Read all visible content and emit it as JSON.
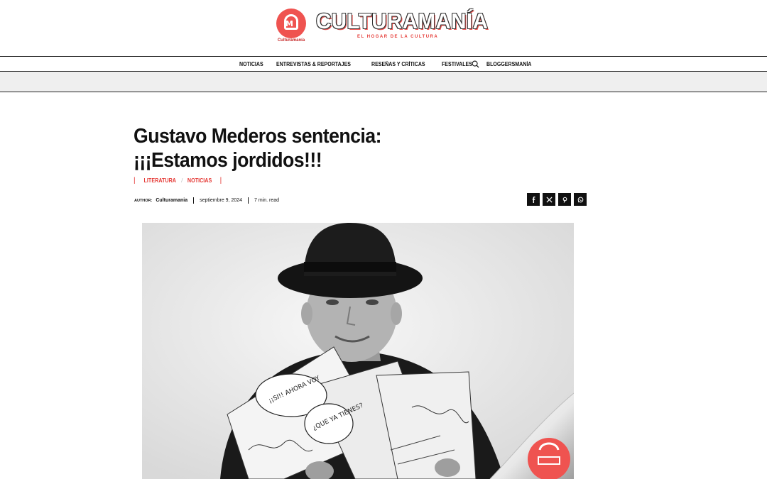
{
  "header": {
    "brand": "CULTURAMANÍA",
    "tagline": "EL HOGAR DE LA CULTURA",
    "logo_caption": "Culturamanía"
  },
  "nav": {
    "items": [
      "NOTICIAS",
      "ENTREVISTAS & REPORTAJES",
      "RESEÑAS Y CRÍTICAS",
      "FESTIVALES",
      "BLOGGERSMANÍA"
    ]
  },
  "article": {
    "title": "Gustavo Mederos sentencia: ¡¡¡Estamos jordidos!!!",
    "categories": [
      "LITERATURA",
      "NOTICIAS"
    ],
    "author_label": "AUTHOR:",
    "author": "Culturamania",
    "date": "septiembre 9, 2024",
    "read_time": "7 min. read"
  },
  "share": {
    "buttons": [
      "facebook-icon",
      "x-icon",
      "pinterest-icon",
      "whatsapp-icon"
    ]
  },
  "comic": {
    "bubble1": "¡¡SI!! AHORA VOY A APROVECHAR PARA HACERME UN SELFIE",
    "bubble2": "¿QUE YA TIENES?"
  },
  "colors": {
    "accent": "#e53935",
    "logo_red": "#ef5350",
    "text": "#111111",
    "band": "#efefef"
  }
}
